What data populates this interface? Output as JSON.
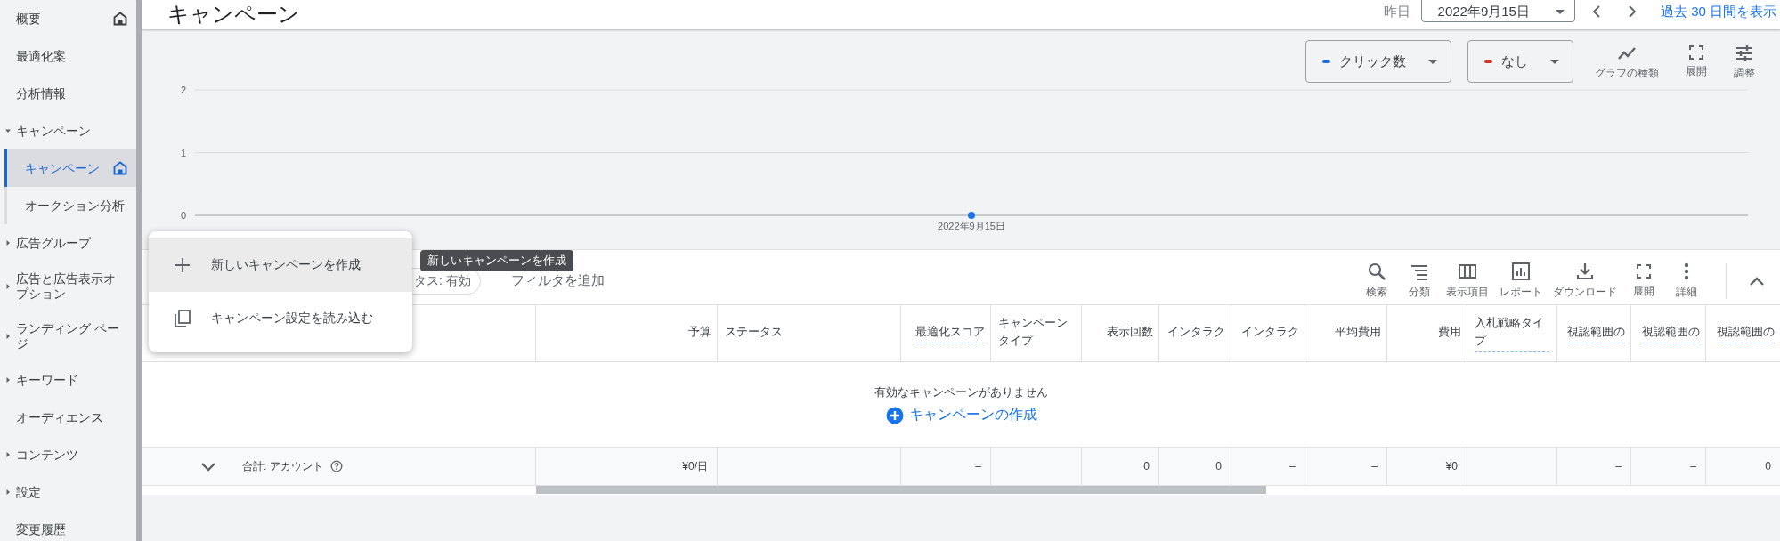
{
  "sidebar": {
    "items": [
      {
        "label": "概要",
        "selected": false,
        "home_icon": true
      },
      {
        "label": "最適化案",
        "selected": false,
        "home_icon": false
      },
      {
        "label": "分析情報",
        "selected": false,
        "home_icon": false
      },
      {
        "label": "キャンペーン",
        "selected": false,
        "home_icon": false,
        "expanded": true,
        "children": [
          {
            "label": "キャンペーン",
            "selected": true,
            "home_icon": true
          },
          {
            "label": "オークション分析",
            "selected": false,
            "home_icon": false
          }
        ]
      },
      {
        "label": "広告グループ",
        "selected": false,
        "home_icon": false,
        "expanded": false
      },
      {
        "label": "広告と広告表示オプション",
        "selected": false,
        "home_icon": false,
        "expanded": false
      },
      {
        "label": "ランディング ページ",
        "selected": false,
        "home_icon": false,
        "expanded": false
      },
      {
        "label": "キーワード",
        "selected": false,
        "home_icon": false,
        "expanded": false
      },
      {
        "label": "オーディエンス",
        "selected": false,
        "home_icon": false
      },
      {
        "label": "コンテンツ",
        "selected": false,
        "home_icon": false,
        "expanded": false
      },
      {
        "label": "設定",
        "selected": false,
        "home_icon": false,
        "expanded": false
      },
      {
        "label": "変更履歴",
        "selected": false,
        "home_icon": false
      }
    ]
  },
  "header": {
    "title": "キャンペーン",
    "date_label": "昨日",
    "date_value": "2022年9月15日",
    "link": "過去 30 日間を表示"
  },
  "chart_controls": {
    "metrics": [
      {
        "label": "クリック数",
        "color": "#1a73e8"
      },
      {
        "label": "なし",
        "color": "#d93025"
      }
    ],
    "tools": [
      {
        "kind": "chart-type",
        "label": "グラフの種類"
      },
      {
        "kind": "expand",
        "label": "展開"
      },
      {
        "kind": "adjust",
        "label": "調整"
      }
    ]
  },
  "chart_data": {
    "type": "line",
    "categories": [
      "2022年9月15日"
    ],
    "series": [
      {
        "color": "#1a73e8",
        "marker": true,
        "values": [
          0
        ]
      }
    ],
    "ylim": [
      0,
      2
    ],
    "yticks": [
      0,
      1,
      2
    ]
  },
  "table": {
    "toolbar": {
      "filter_chip": "タス: 有効",
      "add_filter": "フィルタを追加",
      "tools": [
        {
          "kind": "search",
          "label": "検索"
        },
        {
          "kind": "segment",
          "label": "分類"
        },
        {
          "kind": "columns",
          "label": "表示項目"
        },
        {
          "kind": "report",
          "label": "レポート"
        },
        {
          "kind": "download",
          "label": "ダウンロード"
        },
        {
          "kind": "expand",
          "label": "展開"
        },
        {
          "kind": "more",
          "label": "詳細"
        }
      ]
    },
    "columns": [
      {
        "label": "予算",
        "kind": "number",
        "underlined": false
      },
      {
        "label": "ステータス",
        "kind": "text",
        "underlined": false
      },
      {
        "label": "最適化スコア",
        "kind": "number",
        "underlined": true
      },
      {
        "label": "キャンペーンタイプ",
        "kind": "text",
        "underlined": false
      },
      {
        "label": "表示回数",
        "kind": "number",
        "underlined": false
      },
      {
        "label": "インタラク",
        "kind": "number",
        "underlined": false
      },
      {
        "label": "インタラク",
        "kind": "number",
        "underlined": false
      },
      {
        "label": "平均費用",
        "kind": "number",
        "underlined": false
      },
      {
        "label": "費用",
        "kind": "number",
        "underlined": false
      },
      {
        "label": "入札戦略タイプ",
        "kind": "text",
        "underlined": true
      },
      {
        "label": "視認範囲の",
        "kind": "number",
        "underlined": true
      },
      {
        "label": "視認範囲の",
        "kind": "number",
        "underlined": true
      },
      {
        "label": "視認範囲の",
        "kind": "number",
        "underlined": true
      }
    ],
    "empty_message": "有効なキャンペーンがありません",
    "create_link": "キャンペーンの作成",
    "total_row": {
      "label": "合計: アカウント",
      "cells": [
        "¥0/日",
        null,
        "–",
        null,
        "0",
        "0",
        "–",
        "–",
        "¥0",
        null,
        "–",
        "–",
        "0"
      ]
    }
  },
  "menu": {
    "items": [
      {
        "kind": "add",
        "label": "新しいキャンペーンを作成",
        "selected": true
      },
      {
        "kind": "copy",
        "label": "キャンペーン設定を読み込む",
        "selected": false
      }
    ]
  },
  "tooltip": "新しいキャンペーンを作成"
}
